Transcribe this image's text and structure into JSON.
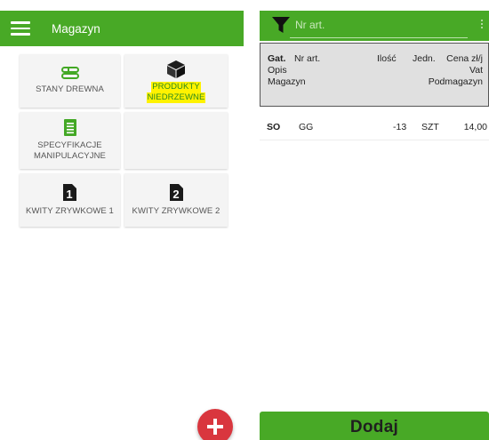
{
  "colors": {
    "primary_green": "#48a926",
    "accent_red": "#d9363e",
    "highlight_yellow": "#fff200"
  },
  "left_screen": {
    "appbar": {
      "menu_icon": "hamburger-menu-icon",
      "title": "Magazyn"
    },
    "tiles": [
      {
        "label": "STANY DREWNA",
        "icon": "log-stack-icon"
      },
      {
        "label_line1": "PRODUKTY",
        "label_line2": "NIEDRZEWNE",
        "icon": "box-icon"
      },
      {
        "label_line1": "SPECYFIKACJE",
        "label_line2": "MANIPULACYJNE",
        "icon": "document-list-icon"
      },
      {
        "label": "KWITY ZRYWKOWE 1",
        "icon": "document-number-1-icon"
      },
      {
        "label": "KWITY ZRYWKOWE 2",
        "icon": "document-number-2-icon"
      }
    ],
    "fab_icon": "plus-icon"
  },
  "right_screen": {
    "appbar": {
      "filter_icon": "filter-icon",
      "search_placeholder": "Nr art.",
      "search_value": "",
      "more_icon": "more-vertical-icon"
    },
    "header": {
      "gat": "Gat.",
      "nr_art": "Nr art.",
      "ilosc": "Ilość",
      "jedn": "Jedn.",
      "cena": "Cena zł/j",
      "opis": "Opis",
      "vat": "Vat",
      "magazyn": "Magazyn",
      "podmagazyn": "Podmagazyn"
    },
    "rows": [
      {
        "gat": "SO",
        "nr_art": "GG",
        "ilosc": "-13",
        "jedn": "SZT",
        "cena": "14,00"
      }
    ],
    "add_button_label": "Dodaj"
  }
}
